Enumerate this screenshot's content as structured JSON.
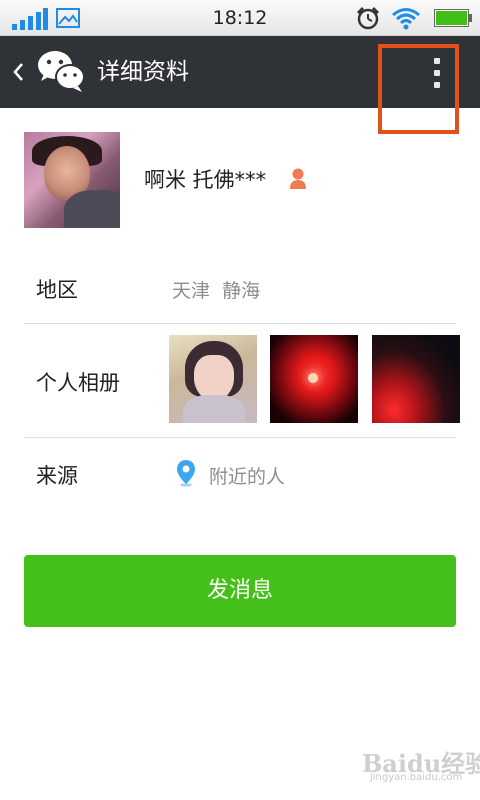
{
  "status_bar": {
    "time": "18:12",
    "icons": [
      "signal-icon",
      "image-icon",
      "alarm-icon",
      "wifi-icon",
      "battery-icon"
    ],
    "signal_color": "#1f8de6",
    "battery_color": "#3fbf17"
  },
  "header": {
    "title": "详细资料",
    "back_icon": "chevron-left-icon",
    "logo": "wechat-logo",
    "more_icon": "vertical-ellipsis-icon",
    "background": "#2f3236",
    "highlight_color": "#e2511a"
  },
  "profile": {
    "nickname": "啊米 托佛***",
    "gender_icon": "female-icon",
    "gender_color": "#f07a52"
  },
  "details": {
    "region_label": "地区",
    "region_value": "天津  静海",
    "album_label": "个人相册",
    "album_photo_count": 3,
    "source_label": "来源",
    "source_value": "附近的人",
    "source_icon": "location-pin-icon"
  },
  "actions": {
    "send_message": "发消息",
    "send_color": "#45c01a"
  },
  "watermark": {
    "text": "Baidu经验",
    "sub": "jingyan.baidu.com"
  }
}
